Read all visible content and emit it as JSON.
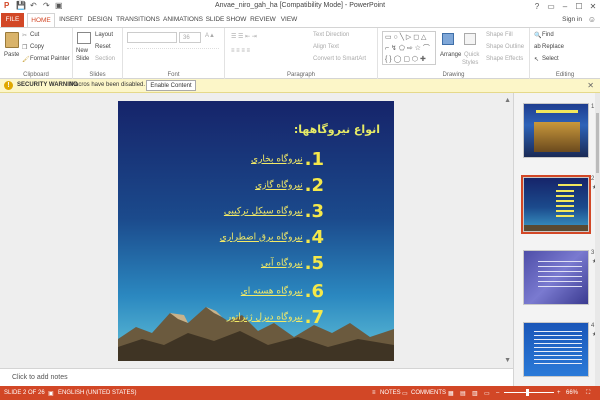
{
  "window": {
    "title": "Anvae_niro_gah_ha [Compatibility Mode] - PowerPoint",
    "controls": [
      "?",
      "▭",
      "–",
      "☐",
      "✕"
    ]
  },
  "quick_access": {
    "app_icon": "powerpoint-icon",
    "save_icon": "save-icon",
    "undo_icon": "undo-icon",
    "redo_icon": "redo-icon",
    "start_icon": "start-from-beginning-icon"
  },
  "tabs": [
    "FILE",
    "HOME",
    "INSERT",
    "DESIGN",
    "TRANSITIONS",
    "ANIMATIONS",
    "SLIDE SHOW",
    "REVIEW",
    "VIEW"
  ],
  "active_tab": "HOME",
  "signin": "Sign in",
  "ribbon": {
    "clipboard": {
      "label": "Clipboard",
      "paste": "Paste",
      "cut": "Cut",
      "copy": "Copy",
      "format_painter": "Format Painter"
    },
    "slides": {
      "label": "Slides",
      "new_slide": "New",
      "new_slide_2": "Slide",
      "layout": "Layout",
      "reset": "Reset",
      "section": "Section"
    },
    "font": {
      "label": "Font",
      "size": "36"
    },
    "paragraph": {
      "label": "Paragraph",
      "text_direction": "Text Direction",
      "align_text": "Align Text",
      "convert_smartart": "Convert to SmartArt"
    },
    "drawing": {
      "label": "Drawing",
      "arrange": "Arrange",
      "quick_styles_1": "Quick",
      "quick_styles_2": "Styles",
      "shape_fill": "Shape Fill",
      "shape_outline": "Shape Outline",
      "shape_effects": "Shape Effects"
    },
    "editing": {
      "label": "Editing",
      "find": "Find",
      "replace": "Replace",
      "select": "Select"
    }
  },
  "security_bar": {
    "title": "SECURITY WARNING",
    "message": "Macros have been disabled.",
    "button": "Enable Content",
    "close": "✕"
  },
  "slide": {
    "title": "انواع نیروگاهها:",
    "items": [
      {
        "num": "1.",
        "text": "نیروگاه بخاری"
      },
      {
        "num": "2.",
        "text": "نیروگاه گازی"
      },
      {
        "num": "3.",
        "text": "نیروگاه سیکل ترکیبی"
      },
      {
        "num": "4.",
        "text": "نیروگاه برق اضطراری"
      },
      {
        "num": "5.",
        "text": "نیروگاه آبی"
      },
      {
        "num": "6.",
        "text": "نیروگاه هسته ای"
      },
      {
        "num": "7.",
        "text": "نیروگاه دیزل ژنراتور"
      }
    ]
  },
  "thumbnails": [
    {
      "num": "1",
      "star": ""
    },
    {
      "num": "2",
      "star": "★"
    },
    {
      "num": "3",
      "star": "★"
    },
    {
      "num": "4",
      "star": "★"
    }
  ],
  "notes": "Click to add notes",
  "status": {
    "slide": "SLIDE 2 OF 26",
    "language": "ENGLISH (UNITED STATES)",
    "notes": "NOTES",
    "comments": "COMMENTS",
    "zoom": "66%"
  },
  "colors": {
    "accent": "#d24726",
    "slide_text": "#f3ea66"
  }
}
